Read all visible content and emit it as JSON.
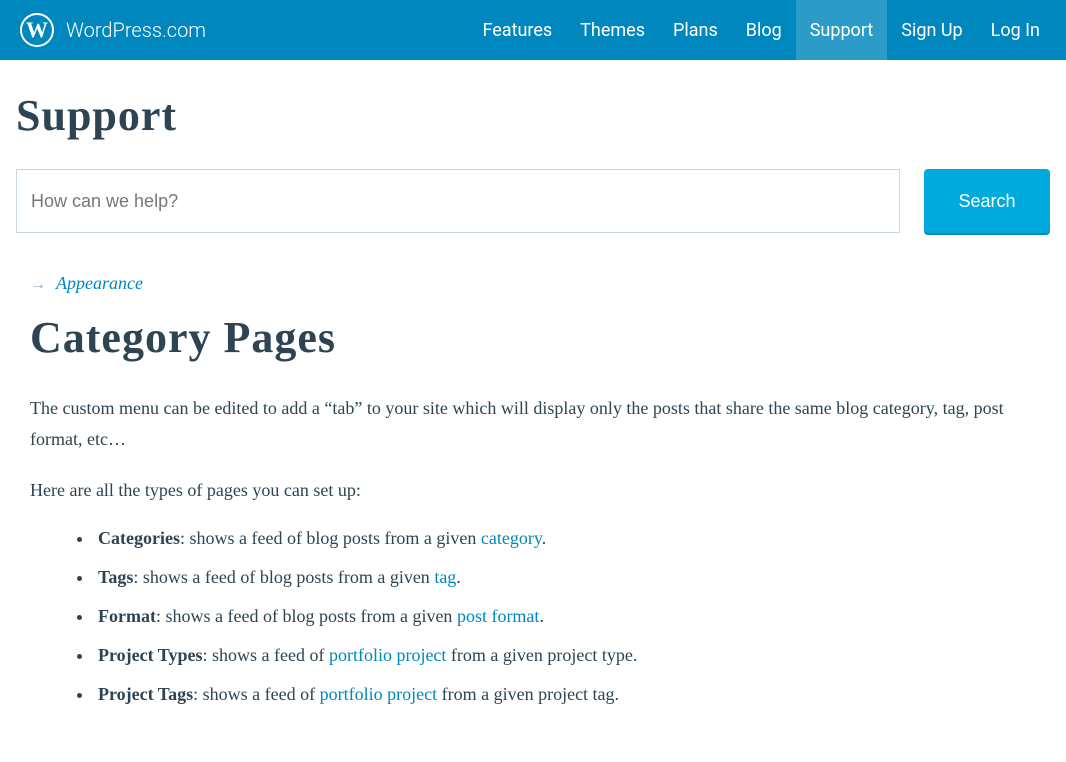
{
  "header": {
    "site": "WordPress.com",
    "nav": {
      "features": "Features",
      "themes": "Themes",
      "plans": "Plans",
      "blog": "Blog",
      "support": "Support",
      "signup": "Sign Up",
      "login": "Log In"
    }
  },
  "support": {
    "title": "Support",
    "search_placeholder": "How can we help?",
    "search_button": "Search"
  },
  "breadcrumb": {
    "parent": "Appearance"
  },
  "page": {
    "title": "Category Pages",
    "intro": "The custom menu can be edited to add a “tab” to your site which will display only the posts that share the same blog category, tag, post format, etc…",
    "list_intro": "Here are all the types of pages you can set up:",
    "items": [
      {
        "label": "Categories",
        "before": ": shows a feed of blog posts from a given ",
        "link": "category",
        "after": "."
      },
      {
        "label": "Tags",
        "before": ": shows a feed of blog posts from a given ",
        "link": "tag",
        "after": "."
      },
      {
        "label": "Format",
        "before": ": shows a feed of blog posts from a given ",
        "link": "post format",
        "after": "."
      },
      {
        "label": "Project Types",
        "before": ": shows a feed of ",
        "link": "portfolio project",
        "after": " from a given project type."
      },
      {
        "label": "Project Tags",
        "before": ": shows a feed of ",
        "link": "portfolio project",
        "after": " from a given project tag."
      }
    ]
  }
}
